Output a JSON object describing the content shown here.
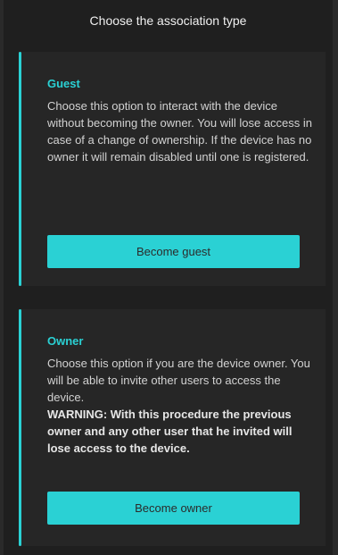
{
  "header": {
    "title": "Choose the association type"
  },
  "guest": {
    "title": "Guest",
    "description": "Choose this option to interact with the device without becoming the owner. You will lose access in case of a change of ownership. If the device has no owner it will remain disabled until one is registered.",
    "button_label": "Become guest"
  },
  "owner": {
    "title": "Owner",
    "description": "Choose this option if you are the device owner. You will be able to invite other users to access the device.",
    "warning": "WARNING: With this procedure the previous owner and any other user that he invited will lose access to the device.",
    "button_label": "Become owner"
  },
  "colors": {
    "accent": "#2ad1d4",
    "background": "#1f1f1f",
    "card": "#262626"
  }
}
